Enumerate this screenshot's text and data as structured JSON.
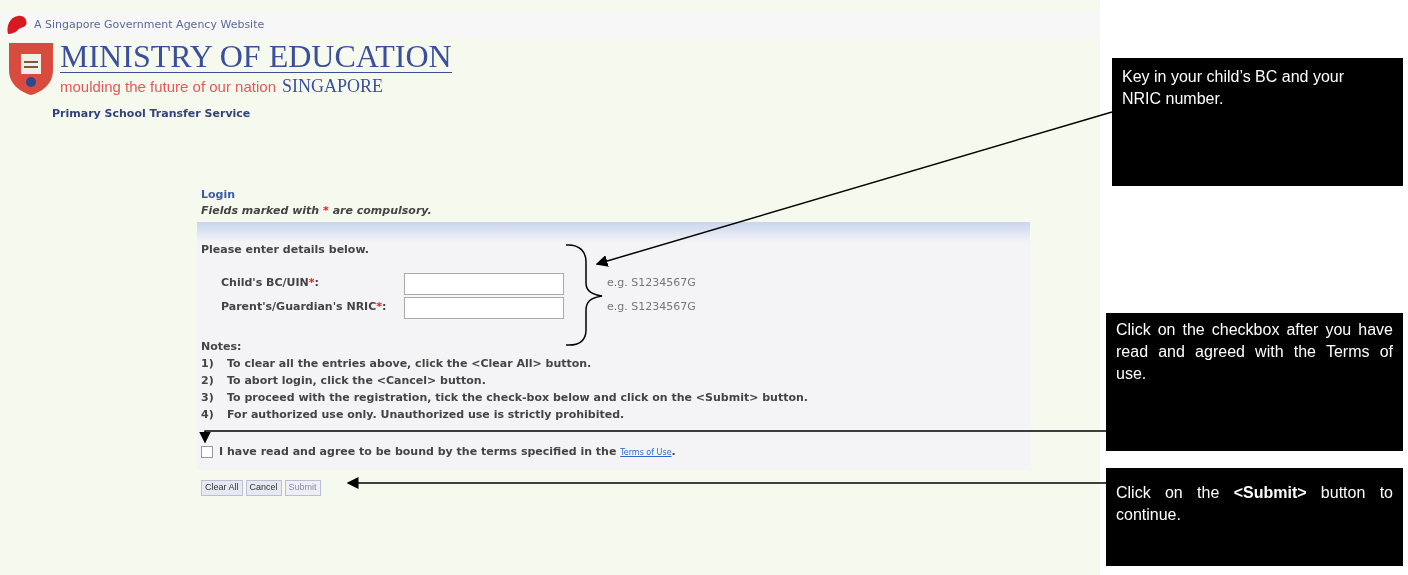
{
  "agency_bar": {
    "text": "A Singapore Government Agency Website"
  },
  "logo": {
    "title": "MINISTRY OF EDUCATION",
    "tagline": "moulding the future of our nation",
    "country": "SINGAPORE"
  },
  "service_title": "Primary School Transfer Service",
  "login": {
    "heading": "Login",
    "legend": {
      "before": "Fields marked with",
      "mark": "*",
      "after": "are compulsory."
    },
    "band_title": "Please enter details below.",
    "fields": [
      {
        "label": "Child's BC/UIN",
        "mark": "*",
        "colon": ":",
        "hint": "e.g. S1234567G"
      },
      {
        "label": "Parent's/Guardian's NRIC",
        "mark": "*",
        "colon": ":",
        "hint": "e.g. S1234567G"
      }
    ],
    "notes_title": "Notes:",
    "notes": [
      {
        "num": "1)",
        "text": "To clear all the entries above, click the <Clear All> button."
      },
      {
        "num": "2)",
        "text": "To abort login, click the <Cancel> button."
      },
      {
        "num": "3)",
        "text": "To proceed with the registration, tick the check-box below and click on the <Submit> button."
      },
      {
        "num": "4)",
        "text": "For authorized use only. Unauthorized use is strictly prohibited."
      }
    ],
    "agree": {
      "checked": false,
      "text": "I have read and agree to be bound by the terms specified in the",
      "link": "Terms of Use",
      "end": "."
    },
    "buttons": [
      {
        "label": "Clear All",
        "disabled": false
      },
      {
        "label": "Cancel",
        "disabled": false
      },
      {
        "label": "Submit",
        "disabled": true
      }
    ]
  },
  "callouts": [
    {
      "text": "Key in your child’s BC and your  NRIC number.",
      "justify": false
    },
    {
      "text": "Click on the checkbox after you have read and agreed with the Terms of use.",
      "justify": true
    },
    {
      "text": "Click on the **<Submit>** button to continue.",
      "justify": true
    }
  ]
}
